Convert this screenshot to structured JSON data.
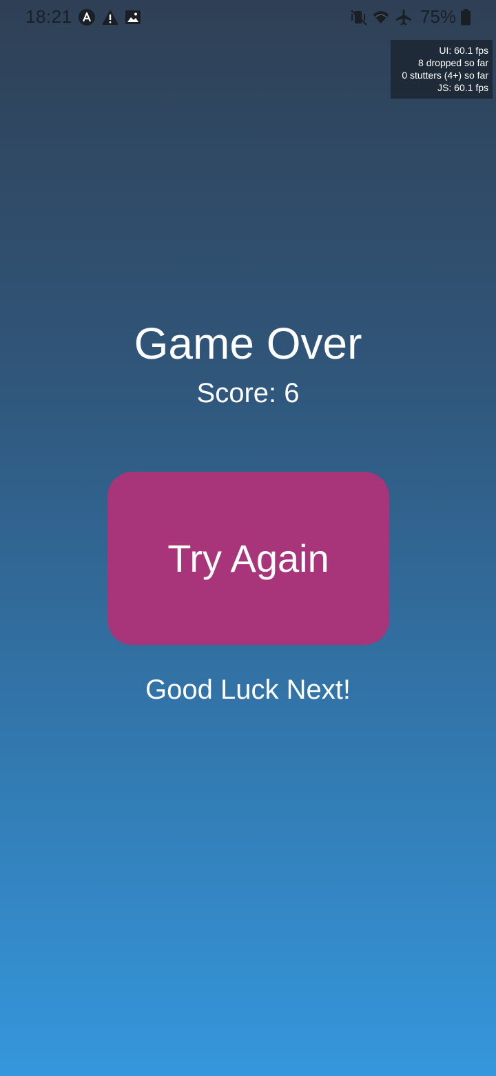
{
  "status_bar": {
    "time": "18:21",
    "battery": "75%",
    "left_icons": [
      "app-notification-icon",
      "warning-icon",
      "image-icon"
    ],
    "right_icons": [
      "vibrate-mute-icon",
      "wifi-icon",
      "airplane-icon",
      "battery-icon"
    ],
    "icon_color": "#1a1f26"
  },
  "perf_monitor": {
    "ui_fps": "UI: 60.1 fps",
    "dropped": "8 dropped so far",
    "stutters": "0 stutters (4+) so far",
    "js_fps": "JS: 60.1 fps"
  },
  "game_over": {
    "title": "Game Over",
    "score": "Score: 6",
    "try_again": "Try Again",
    "message": "Good Luck Next!"
  },
  "colors": {
    "button": "#a83479",
    "background_top": "#2f4055",
    "background_bottom": "#3597dc"
  }
}
